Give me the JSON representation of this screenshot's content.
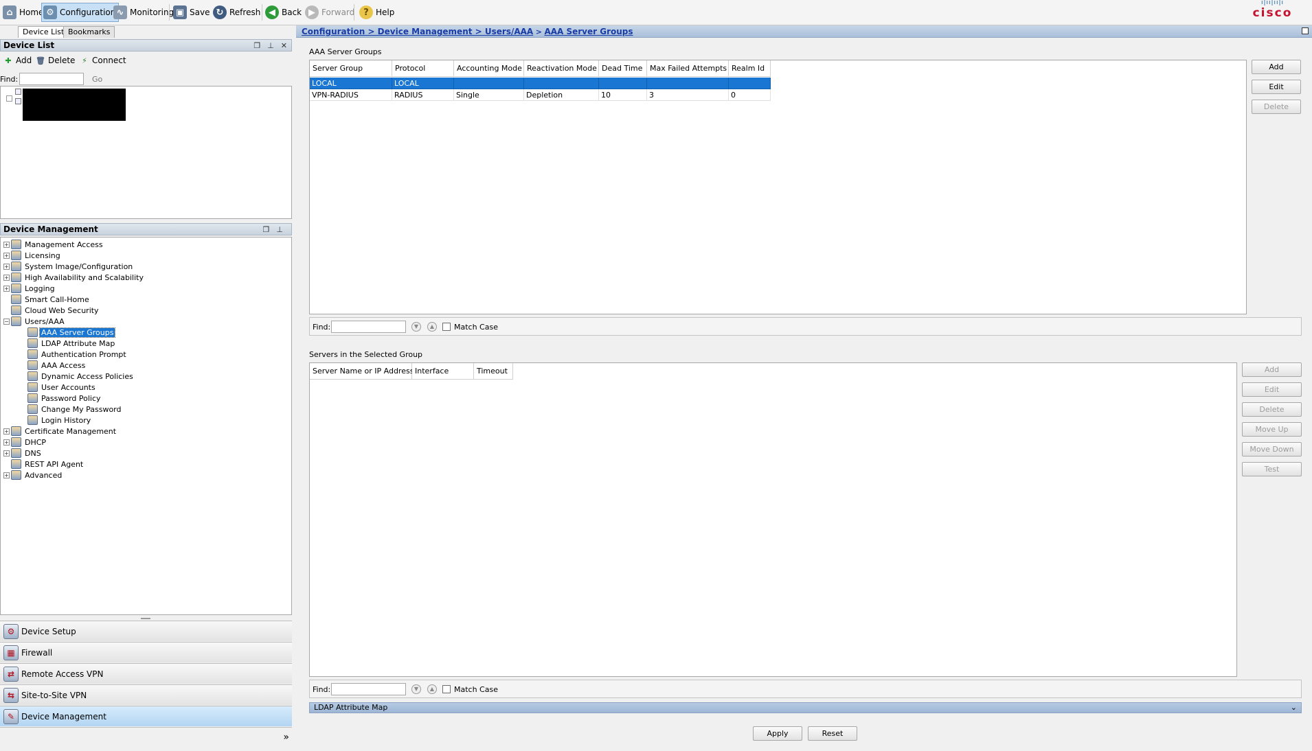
{
  "toolbar": {
    "home": "Home",
    "configuration": "Configuration",
    "monitoring": "Monitoring",
    "save": "Save",
    "refresh": "Refresh",
    "back": "Back",
    "forward": "Forward",
    "help": "Help",
    "brand": "cisco"
  },
  "left": {
    "tabs": [
      "Device List",
      "Bookmarks"
    ],
    "device_list_title": "Device List",
    "add": "Add",
    "delete": "Delete",
    "connect": "Connect",
    "find_label": "Find:",
    "go": "Go",
    "device_mgmt_title": "Device Management",
    "tree": [
      "Management Access",
      "Licensing",
      "System Image/Configuration",
      "High Availability and Scalability",
      "Logging",
      "Smart Call-Home",
      "Cloud Web Security",
      "Users/AAA",
      "AAA Server Groups",
      "LDAP Attribute Map",
      "Authentication Prompt",
      "AAA Access",
      "Dynamic Access Policies",
      "User Accounts",
      "Password Policy",
      "Change My Password",
      "Login History",
      "Certificate Management",
      "DHCP",
      "DNS",
      "REST API Agent",
      "Advanced"
    ],
    "nav": [
      "Device Setup",
      "Firewall",
      "Remote Access VPN",
      "Site-to-Site VPN",
      "Device Management"
    ],
    "more": "»"
  },
  "breadcrumb": {
    "path": "Configuration > Device Management > Users/AAA",
    "sep": ">",
    "current": "AAA Server Groups"
  },
  "groups": {
    "title": "AAA Server Groups",
    "columns": [
      "Server Group",
      "Protocol",
      "Accounting Mode",
      "Reactivation Mode",
      "Dead Time",
      "Max Failed Attempts",
      "Realm Id"
    ],
    "rows": [
      [
        "LOCAL",
        "LOCAL",
        "",
        "",
        "",
        "",
        ""
      ],
      [
        "VPN-RADIUS",
        "RADIUS",
        "Single",
        "Depletion",
        "10",
        "3",
        "0"
      ]
    ],
    "buttons": [
      "Add",
      "Edit",
      "Delete"
    ]
  },
  "servers": {
    "title": "Servers in the Selected Group",
    "columns": [
      "Server Name or IP Address",
      "Interface",
      "Timeout"
    ],
    "buttons": [
      "Add",
      "Edit",
      "Delete",
      "Move Up",
      "Move Down",
      "Test"
    ]
  },
  "find": {
    "label": "Find:",
    "match_case": "Match Case"
  },
  "ldap_bar": "LDAP Attribute Map",
  "footer": {
    "apply": "Apply",
    "reset": "Reset"
  }
}
